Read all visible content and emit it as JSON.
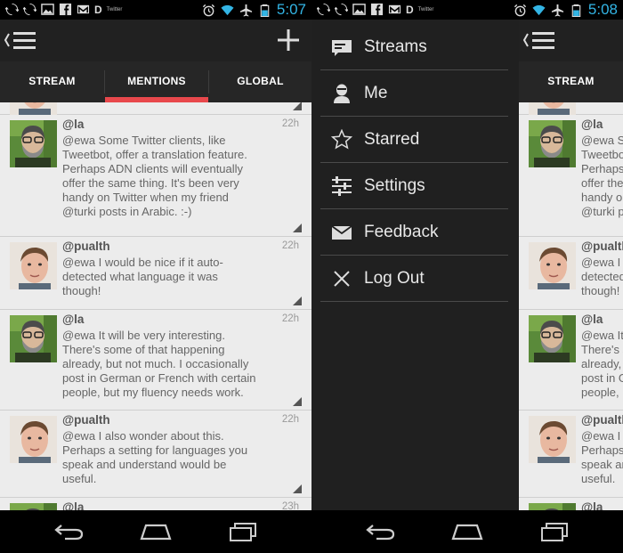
{
  "status_left": {
    "app_label": "Twitter",
    "time": "5:07"
  },
  "status_right": {
    "app_label": "Twitter",
    "time": "5:08"
  },
  "tabs": [
    {
      "label": "STREAM",
      "active": false
    },
    {
      "label": "MENTIONS",
      "active": true
    },
    {
      "label": "GLOBAL",
      "active": false
    }
  ],
  "posts": [
    {
      "username": "@la",
      "time": "22h",
      "text": "@ewa Some Twitter clients, like\nTweetbot, offer a translation feature.\nPerhaps ADN clients will eventually\noffer the same thing. It's been very\nhandy on Twitter when my friend\n@turki posts in Arabic. :-)",
      "avatar": "bearded-man"
    },
    {
      "username": "@pualth",
      "time": "22h",
      "text": "@ewa I would be nice if it auto-\ndetected what language it was\nthough!",
      "avatar": "young-man"
    },
    {
      "username": "@la",
      "time": "22h",
      "text": "@ewa It will be very interesting.\nThere's some of that happening\nalready, but not much. I occasionally\npost in German or French with certain\npeople, but my fluency needs work.",
      "avatar": "bearded-man"
    },
    {
      "username": "@pualth",
      "time": "22h",
      "text": "@ewa I also wonder about this.\nPerhaps a setting for languages you\nspeak and understand would be\nuseful.",
      "avatar": "young-man"
    },
    {
      "username": "@la",
      "time": "23h",
      "text": "",
      "avatar": "bearded-man"
    }
  ],
  "menu": [
    {
      "label": "Streams",
      "icon": "streams-icon"
    },
    {
      "label": "Me",
      "icon": "person-icon"
    },
    {
      "label": "Starred",
      "icon": "star-icon"
    },
    {
      "label": "Settings",
      "icon": "sliders-icon"
    },
    {
      "label": "Feedback",
      "icon": "envelope-icon"
    },
    {
      "label": "Log Out",
      "icon": "close-icon"
    }
  ],
  "colors": {
    "accent": "#e8484c",
    "status": "#33b5e5",
    "actionbar": "#212121",
    "drawer": "#202020",
    "list_bg": "#ececec"
  }
}
